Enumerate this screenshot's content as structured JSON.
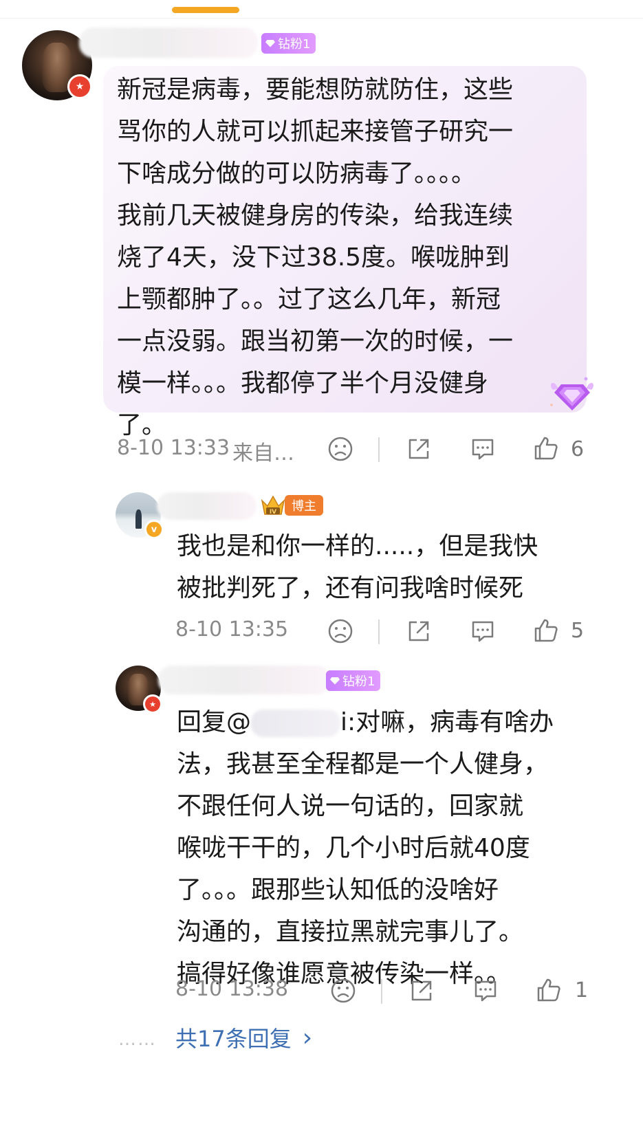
{
  "comment1": {
    "fan_badge": "钻粉1",
    "text": "新冠是病毒，要能想防就防住，这些\n骂你的人就可以抓起来接管子研究一\n下啥成分做的可以防病毒了。。。。\n我前几天被健身房的传染，给我连续\n烧了4天，没下过38.5度。喉咙肿到\n上颚都肿了。。过了这么几年，新冠\n一点没弱。跟当初第一次的时候，一\n模一样。。。我都停了半个月没健身\n了。",
    "time": "8-10 13:33",
    "source": "来自…",
    "likes": "6"
  },
  "reply1": {
    "host_badge": "博主",
    "text": "我也是和你一样的.....，但是我快\n被批判死了，还有问我啥时候死",
    "time": "8-10 13:35",
    "likes": "5"
  },
  "reply2": {
    "fan_badge": "钻粉1",
    "prefix": "回复@",
    "mention_tail": "i",
    "text": ":对嘛，病毒有啥办\n法，我甚至全程都是一个人健身，\n不跟任何人说一句话的，回家就\n喉咙干干的，几个小时后就40度\n了。。。跟那些认知低的没啥好\n沟通的，直接拉黑就完事儿了。\n搞得好像谁愿意被传染一样。。",
    "time": "8-10 13:38",
    "likes": "1"
  },
  "more_replies": {
    "dots": "……",
    "label": "共17条回复",
    "arrow": "›"
  },
  "icons": [
    "sad-face-icon",
    "share-icon",
    "comment-icon",
    "thumbs-up-icon",
    "chevron-right-icon",
    "diamond-icon",
    "crown-icon"
  ],
  "colors": {
    "link": "#3e6fb3",
    "fan_badge": "#c77dff",
    "host_badge": "#f07c2e",
    "verified": "#e8402f"
  }
}
